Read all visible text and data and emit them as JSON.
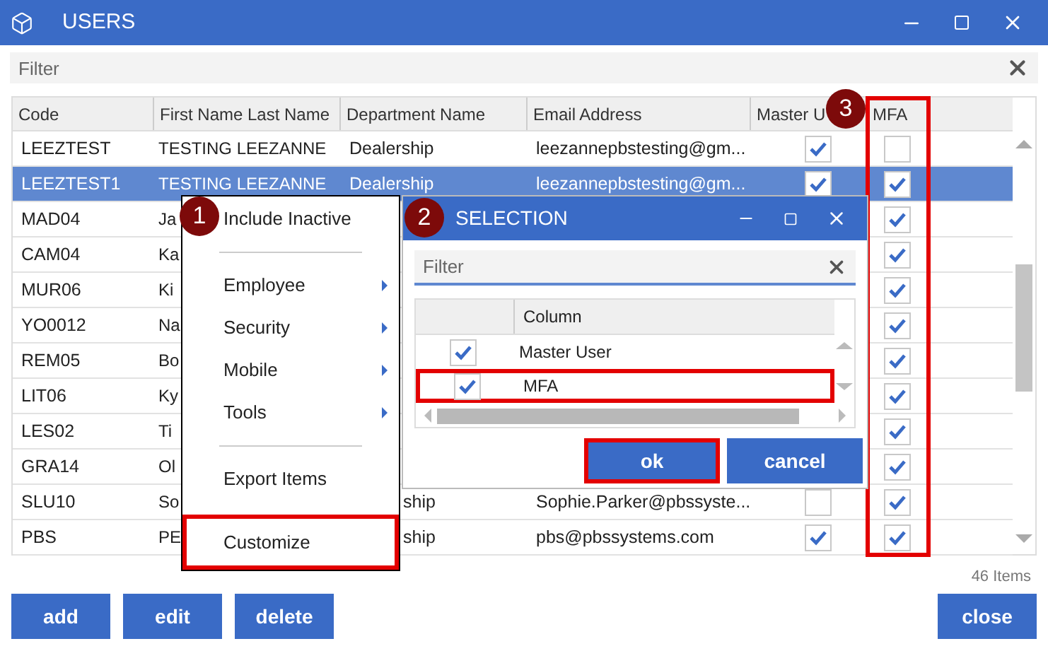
{
  "window": {
    "title": "USERS"
  },
  "filter": {
    "placeholder": "Filter"
  },
  "table": {
    "columns": [
      "Code",
      "First Name Last Name",
      "Department Name",
      "Email Address",
      "Master U",
      "MFA"
    ],
    "mfa_highlighted": true,
    "rows": [
      {
        "code": "LEEZTEST",
        "name": "TESTING LEEZANNE",
        "department": "Dealership",
        "email": "leezannepbstesting@gm...",
        "master_user": true,
        "mfa": false,
        "selected": false
      },
      {
        "code": "LEEZTEST1",
        "name": "TESTING LEEZANNE",
        "department": "Dealership",
        "email": "leezannepbstesting@gm...",
        "master_user": true,
        "mfa": true,
        "selected": true
      },
      {
        "code": "MAD04",
        "name": "Ja",
        "mfa": true,
        "selected": false
      },
      {
        "code": "CAM04",
        "name": "Ka",
        "mfa": true,
        "selected": false
      },
      {
        "code": "MUR06",
        "name": "Ki",
        "mfa": true,
        "selected": false
      },
      {
        "code": "YO0012",
        "name": "Na",
        "mfa": true,
        "selected": false
      },
      {
        "code": "REM05",
        "name": "Bo",
        "mfa": true,
        "selected": false
      },
      {
        "code": "LIT06",
        "name": "Ky",
        "mfa": true,
        "selected": false
      },
      {
        "code": "LES02",
        "name": "Ti",
        "mfa": true,
        "selected": false
      },
      {
        "code": "GRA14",
        "name": "Ol",
        "mfa": true,
        "selected": false
      },
      {
        "code": "SLU10",
        "name": "So",
        "department": "ship",
        "department_cut": true,
        "email": "Sophie.Parker@pbssyste...",
        "master_user": false,
        "mfa": true,
        "selected": false
      },
      {
        "code": "PBS",
        "name": "PE",
        "department": "ship",
        "department_cut": true,
        "email": "pbs@pbssystems.com",
        "master_user": true,
        "mfa": true,
        "selected": false
      }
    ]
  },
  "item_count": "46 Items",
  "buttons": [
    "add",
    "edit",
    "delete"
  ],
  "close_button": "close",
  "context_menu": {
    "items": [
      {
        "kind": "item",
        "label": "Include Inactive",
        "highlighted": false
      },
      {
        "kind": "separator"
      },
      {
        "kind": "submenu",
        "label": "Employee"
      },
      {
        "kind": "submenu",
        "label": "Security"
      },
      {
        "kind": "submenu",
        "label": "Mobile"
      },
      {
        "kind": "submenu",
        "label": "Tools"
      },
      {
        "kind": "separator"
      },
      {
        "kind": "item",
        "label": "Export Items",
        "highlighted": false
      },
      {
        "kind": "item",
        "label": "Customize",
        "highlighted": true
      }
    ]
  },
  "dialog": {
    "title": "SELECTION",
    "filter": {
      "placeholder": "Filter"
    },
    "column_header": "Column",
    "rows": [
      {
        "label": "Master User",
        "checked": true,
        "highlighted": false
      },
      {
        "label": "MFA",
        "checked": true,
        "highlighted": true
      }
    ],
    "ok": {
      "label": "ok",
      "highlighted": true
    },
    "cancel": {
      "label": "cancel",
      "highlighted": false
    }
  },
  "callouts": [
    "1",
    "2",
    "3"
  ]
}
